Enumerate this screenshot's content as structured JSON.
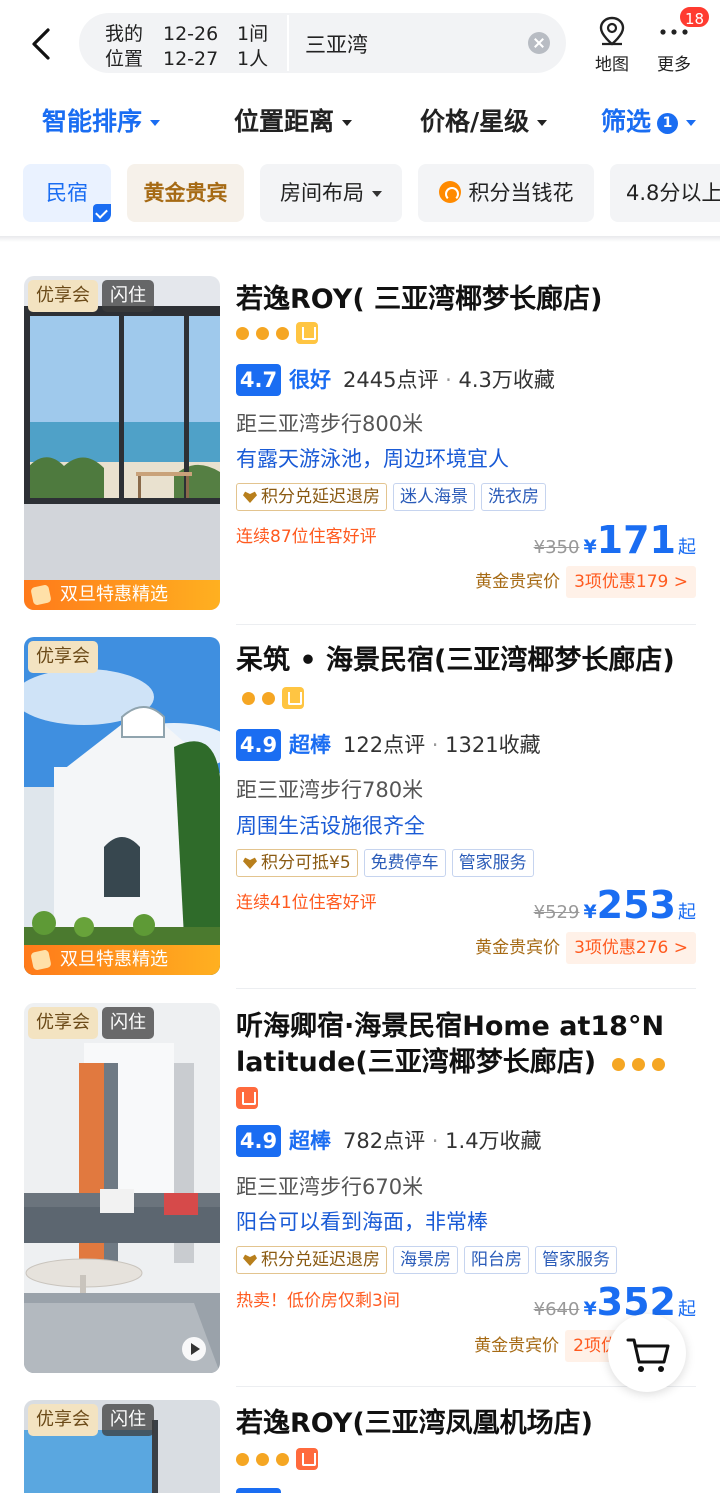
{
  "search": {
    "date_label_1": "我的",
    "date_label_2": "位置",
    "checkin": "12-26",
    "checkout": "12-27",
    "rooms": "1间",
    "guests": "1人",
    "keyword": "三亚湾"
  },
  "actions": {
    "map_label": "地图",
    "more_label": "更多",
    "more_badge": "18"
  },
  "sortbar": {
    "smart_sort": "智能排序",
    "distance": "位置距离",
    "price_star": "价格/星级",
    "filter": "筛选",
    "filter_count": "1"
  },
  "chips": {
    "homestay": "民宿",
    "gold_vip": "黄金贵宾",
    "layout": "房间布局",
    "points": "积分当钱花",
    "rating": "4.8分以上"
  },
  "listings": [
    {
      "title": "若逸ROY( 三亚湾椰梦长廊店)",
      "diamonds": 3,
      "photo_tags": [
        "优享会",
        "闪住"
      ],
      "promo": "双旦特惠精选",
      "score": "4.7",
      "grade": "很好",
      "reviews": "2445点评",
      "favorites": "4.3万收藏",
      "distance": "距三亚湾步行800米",
      "highlight": "有露天游泳池，周边环境宜人",
      "tags": [
        "积分兑延迟退房",
        "迷人海景",
        "洗衣房"
      ],
      "ugc": "连续87位住客好评",
      "orig_price": "¥350",
      "currency": "¥",
      "price": "171",
      "price_suffix": "起",
      "vip_label": "黄金贵宾价",
      "vip_offer": "3项优惠179 >"
    },
    {
      "title": "呆筑 • 海景民宿(三亚湾椰梦长廊店)",
      "diamonds": 2,
      "photo_tags": [
        "优享会"
      ],
      "promo": "双旦特惠精选",
      "score": "4.9",
      "grade": "超棒",
      "reviews": "122点评",
      "favorites": "1321收藏",
      "distance": "距三亚湾步行780米",
      "highlight": "周围生活设施很齐全",
      "tags": [
        "积分可抵¥5",
        "免费停车",
        "管家服务"
      ],
      "ugc": "连续41位住客好评",
      "orig_price": "¥529",
      "currency": "¥",
      "price": "253",
      "price_suffix": "起",
      "vip_label": "黄金贵宾价",
      "vip_offer": "3项优惠276 >"
    },
    {
      "title": "听海卿宿·海景民宿Home at18°N latitude(三亚湾椰梦长廊店)",
      "diamonds": 3,
      "photo_tags": [
        "优享会",
        "闪住"
      ],
      "score": "4.9",
      "grade": "超棒",
      "reviews": "782点评",
      "favorites": "1.4万收藏",
      "distance": "距三亚湾步行670米",
      "highlight": "阳台可以看到海面，非常棒",
      "tags": [
        "积分兑延迟退房",
        "海景房",
        "阳台房",
        "管家服务"
      ],
      "ugc": "热卖！低价房仅剩3间",
      "orig_price": "¥640",
      "currency": "¥",
      "price": "352",
      "price_suffix": "起",
      "vip_label": "黄金贵宾价",
      "vip_offer": "2项优"
    },
    {
      "title": "若逸ROY(三亚湾凤凰机场店)",
      "diamonds": 3,
      "photo_tags": [
        "优享会",
        "闪住"
      ]
    }
  ],
  "sep": "·",
  "colors": {
    "accent": "#1a6df2",
    "gold": "#a66a14",
    "promo_orange": "#ff5a1f",
    "diamond": "#f5a623"
  }
}
